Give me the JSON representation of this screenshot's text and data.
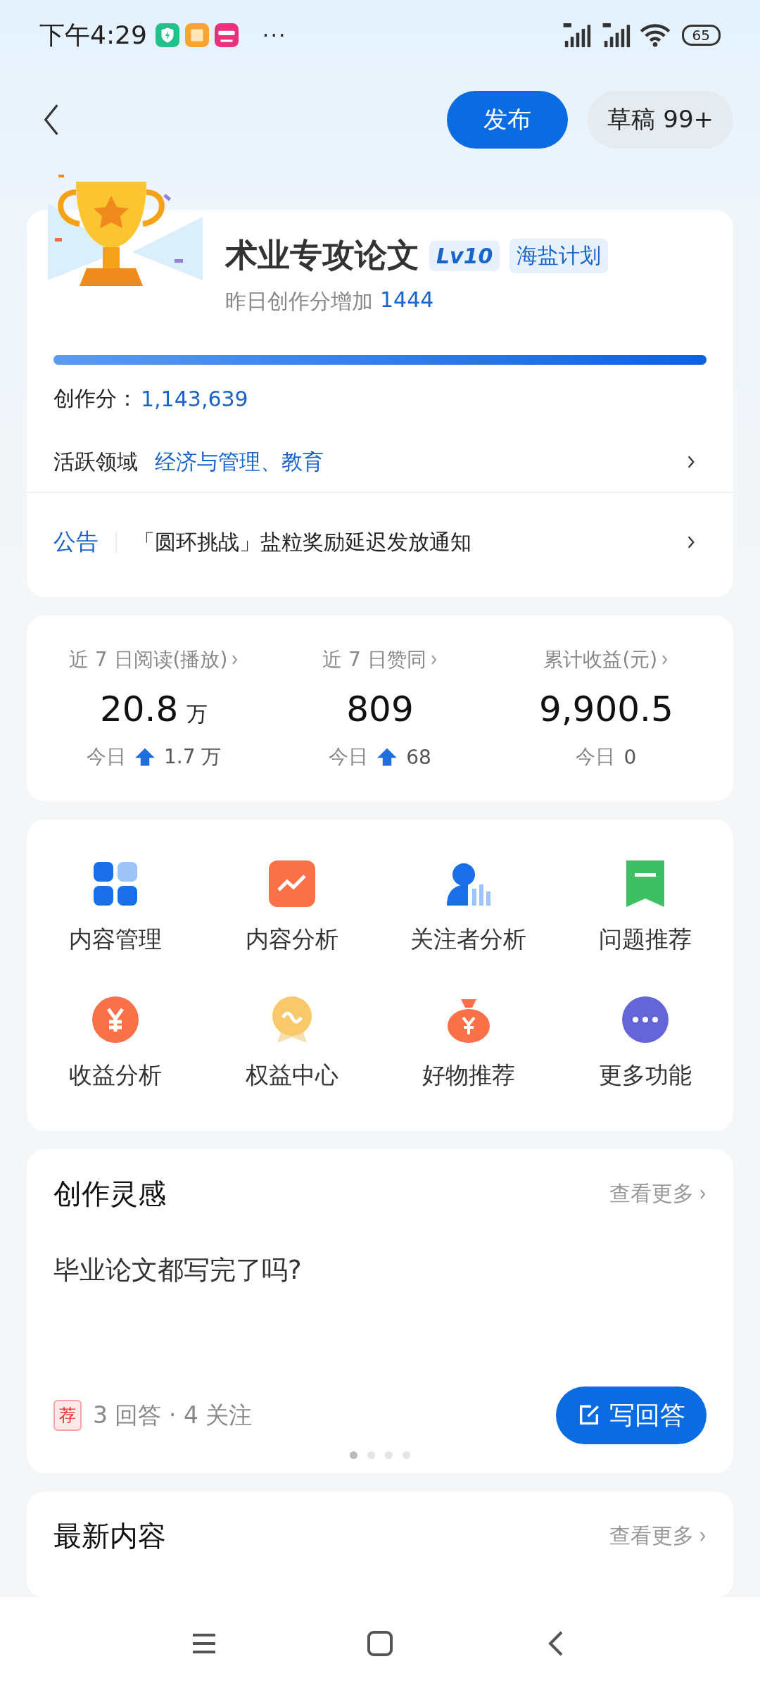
{
  "status_bar": {
    "time": "下午4:29",
    "notification_icons": [
      {
        "kind": "shield",
        "color": "#22c08a"
      },
      {
        "kind": "square",
        "color": "#f7a531"
      },
      {
        "kind": "shop",
        "color": "#e8327c"
      }
    ],
    "more": "···",
    "battery": "65"
  },
  "header": {
    "publish_button": "发布",
    "drafts_button": "草稿 99+"
  },
  "profile": {
    "name": "术业专攻论文",
    "level_badge": "Lv10",
    "plan_badge": "海盐计划",
    "subtitle": "昨日创作分增加",
    "subtitle_value": "1444",
    "progress": {
      "level": 1
    },
    "score_label": "创作分：",
    "score_value": "1,143,639",
    "domain_label": "活跃领域",
    "domain_value": "经济与管理、教育",
    "notice_label": "公告",
    "notice_text": "「圆环挑战」盐粒奖励延迟发放通知"
  },
  "stats": [
    {
      "label": "近 7 日阅读(播放)",
      "value": "20.8",
      "unit": "万",
      "today": "今日",
      "rising": true,
      "delta": "1.7 万"
    },
    {
      "label": "近 7 日赞同",
      "value": "809",
      "today": "今日",
      "rising": true,
      "delta": "68"
    },
    {
      "label": "累计收益(元)",
      "value": "9,900.5",
      "today": "今日",
      "rising": false,
      "delta": "0"
    }
  ],
  "tools": [
    {
      "kind": "grid",
      "label": "内容管理"
    },
    {
      "kind": "chart",
      "label": "内容分析"
    },
    {
      "kind": "person",
      "label": "关注者分析"
    },
    {
      "kind": "flag",
      "label": "问题推荐"
    },
    {
      "kind": "yuan",
      "label": "收益分析"
    },
    {
      "kind": "medal",
      "label": "权益中心"
    },
    {
      "kind": "bag",
      "label": "好物推荐"
    },
    {
      "kind": "dots",
      "label": "更多功能"
    }
  ],
  "inspiration": {
    "title": "创作灵感",
    "more": "查看更多",
    "question": "毕业论文都写完了吗?",
    "tag": "荐",
    "meta": "3 回答 · 4 关注",
    "answer_button": "写回答",
    "pages": [
      {
        "selected": true
      },
      {
        "selected": false
      },
      {
        "selected": false
      },
      {
        "selected": false
      }
    ]
  },
  "latest": {
    "title": "最新内容",
    "more": "查看更多"
  }
}
